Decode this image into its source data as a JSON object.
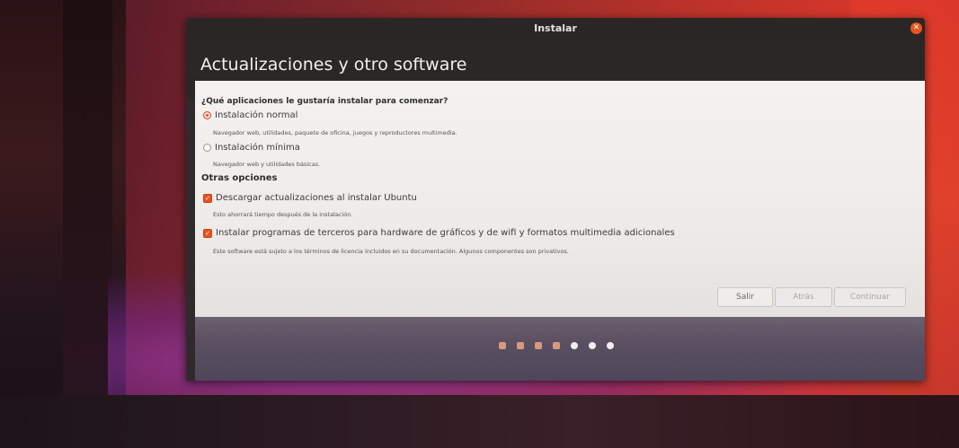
{
  "window": {
    "title": "Instalar"
  },
  "header": {
    "title": "Actualizaciones y otro software"
  },
  "content": {
    "question": "¿Qué aplicaciones le gustaría instalar para comenzar?",
    "options": [
      {
        "label": "Instalación normal",
        "selected": true,
        "description": "Navegador web, utilidades, paquete de oficina, juegos y reproductores multimedia."
      },
      {
        "label": "Instalación mínima",
        "selected": false,
        "description": "Navegador web y utilidades básicas."
      }
    ],
    "other_options_title": "Otras opciones",
    "checkboxes": [
      {
        "label": "Descargar actualizaciones al instalar Ubuntu",
        "checked": true,
        "description": "Esto ahorrará tiempo después de la instalación."
      },
      {
        "label": "Instalar programas de terceros para hardware de gráficos y de wifi y formatos multimedia adicionales",
        "checked": true,
        "description": "Este software está sujeto a los términos de licencia incluidos en su documentación. Algunos componentes son privativos."
      }
    ]
  },
  "buttons": {
    "quit": "Salir",
    "back": "Atrás",
    "continue": "Continuar"
  },
  "progress": {
    "total_steps": 7,
    "completed_steps": 4,
    "accent_color": "#e95420"
  },
  "icons": {
    "close": "close-icon",
    "radio": "radio-icon",
    "checkbox": "checkbox-icon"
  }
}
